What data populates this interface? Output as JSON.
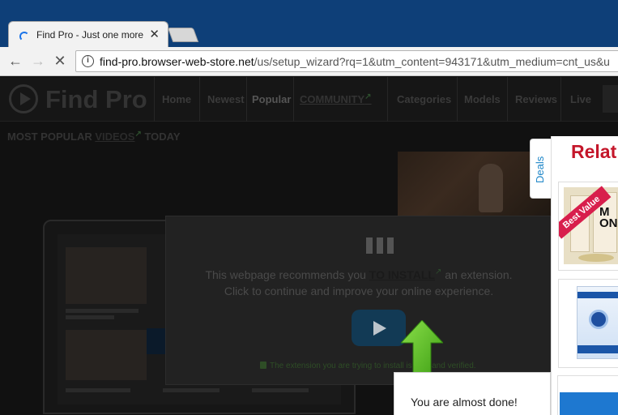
{
  "browser": {
    "tab_title": "Find Pro - Just one more",
    "tab_close_icon": "close-icon",
    "url_domain": "find-pro.browser-web-store.net",
    "url_path": "/us/setup_wizard?rq=1&utm_content=943171&utm_medium=cnt_us&u"
  },
  "site": {
    "logo": "Find Pro",
    "nav": [
      "Home",
      "Newest",
      "Popular",
      "COMMUNITY",
      "Categories",
      "Models",
      "Reviews",
      "Live"
    ],
    "section_prefix": "MOST POPULAR ",
    "section_link": "VIDEOS",
    "section_suffix": " TODAY"
  },
  "modal": {
    "line1_before": "This webpage recommends you ",
    "cta": "TO INSTALL",
    "line1_after": " an extension.",
    "line2": "Click to continue and improve your online experience.",
    "note": "The extension you are trying to install is safe and verified."
  },
  "popup": {
    "text": "You are almost done!"
  },
  "panel": {
    "deals_label": "Deals",
    "title": "Relat",
    "ribbon": "Best Value"
  },
  "colors": {
    "accent_green": "#5cc026",
    "panel_red": "#c4162a",
    "deals_blue": "#1e86c8"
  }
}
